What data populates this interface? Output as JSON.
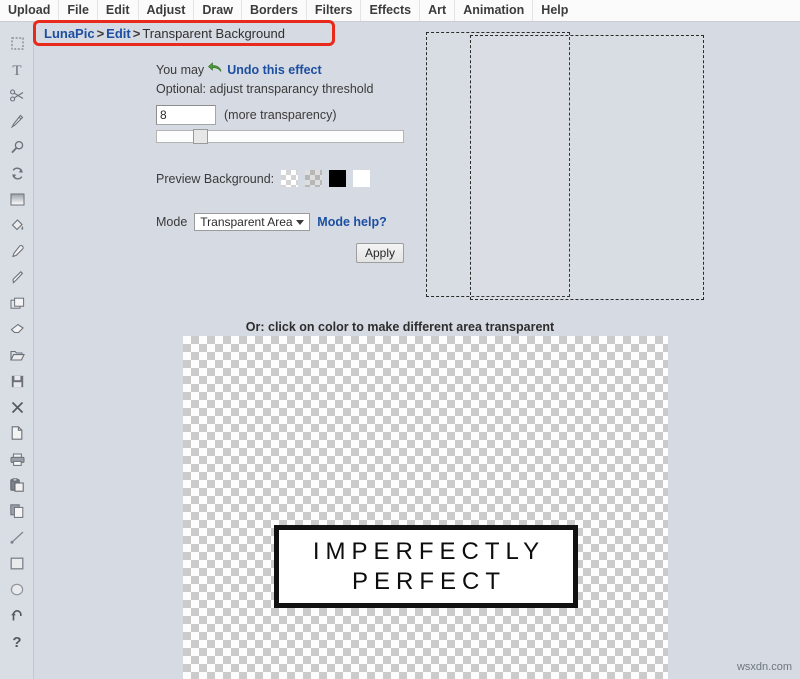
{
  "menu": {
    "items": [
      {
        "label": "Upload",
        "name": "menu-upload"
      },
      {
        "label": "File",
        "name": "menu-file"
      },
      {
        "label": "Edit",
        "name": "menu-edit"
      },
      {
        "label": "Adjust",
        "name": "menu-adjust"
      },
      {
        "label": "Draw",
        "name": "menu-draw"
      },
      {
        "label": "Borders",
        "name": "menu-borders"
      },
      {
        "label": "Filters",
        "name": "menu-filters"
      },
      {
        "label": "Effects",
        "name": "menu-effects"
      },
      {
        "label": "Art",
        "name": "menu-art"
      },
      {
        "label": "Animation",
        "name": "menu-animation"
      },
      {
        "label": "Help",
        "name": "menu-help"
      }
    ]
  },
  "breadcrumb": {
    "root": "LunaPic",
    "separator1": ">",
    "section": "Edit",
    "separator2": ">",
    "current": "Transparent Background",
    "annotation_color": "#e8291c"
  },
  "toolbar": {
    "icons": [
      "marquee-select-icon",
      "text-icon",
      "scissors-icon",
      "pencil-icon",
      "magnifier-icon",
      "rotate-icon",
      "gradient-icon",
      "paint-bucket-icon",
      "eyedropper-icon",
      "paintbrush-icon",
      "layers-icon",
      "eraser-icon",
      "folder-open-icon",
      "save-icon",
      "close-icon",
      "new-document-icon",
      "print-icon",
      "paste-icon",
      "copy-icon",
      "line-icon",
      "rectangle-icon",
      "ellipse-icon",
      "undo-icon",
      "help-icon"
    ]
  },
  "panel": {
    "undo_prefix": "You may",
    "undo_link": "Undo this effect",
    "optional_label": "Optional: adjust transparancy threshold",
    "threshold_value": "8",
    "threshold_hint": "(more transparency)",
    "slider_position_percent": 16,
    "preview_bg_label": "Preview Background:",
    "swatches": [
      {
        "name": "swatch-checker-light",
        "kind": "checker-light"
      },
      {
        "name": "swatch-checker-gray",
        "kind": "checker-gray"
      },
      {
        "name": "swatch-black",
        "kind": "solid-black",
        "color": "#000000"
      },
      {
        "name": "swatch-white",
        "kind": "solid-white",
        "color": "#ffffff"
      }
    ],
    "mode_label": "Mode",
    "mode_value": "Transparent Area",
    "mode_options": [
      "Transparent Area"
    ],
    "mode_help": "Mode help?",
    "apply_label": "Apply"
  },
  "canvas": {
    "caption": "Or: click on color to make different area transparent",
    "sign_line1": "IMPERFECTLY",
    "sign_line2": "PERFECT"
  },
  "watermark": {
    "text": "wsxdn.com"
  },
  "colors": {
    "page_background": "#d6dae2",
    "menu_background": "#fbfbfb",
    "link_blue": "#1c4fa1",
    "annotation_red": "#e8291c"
  }
}
